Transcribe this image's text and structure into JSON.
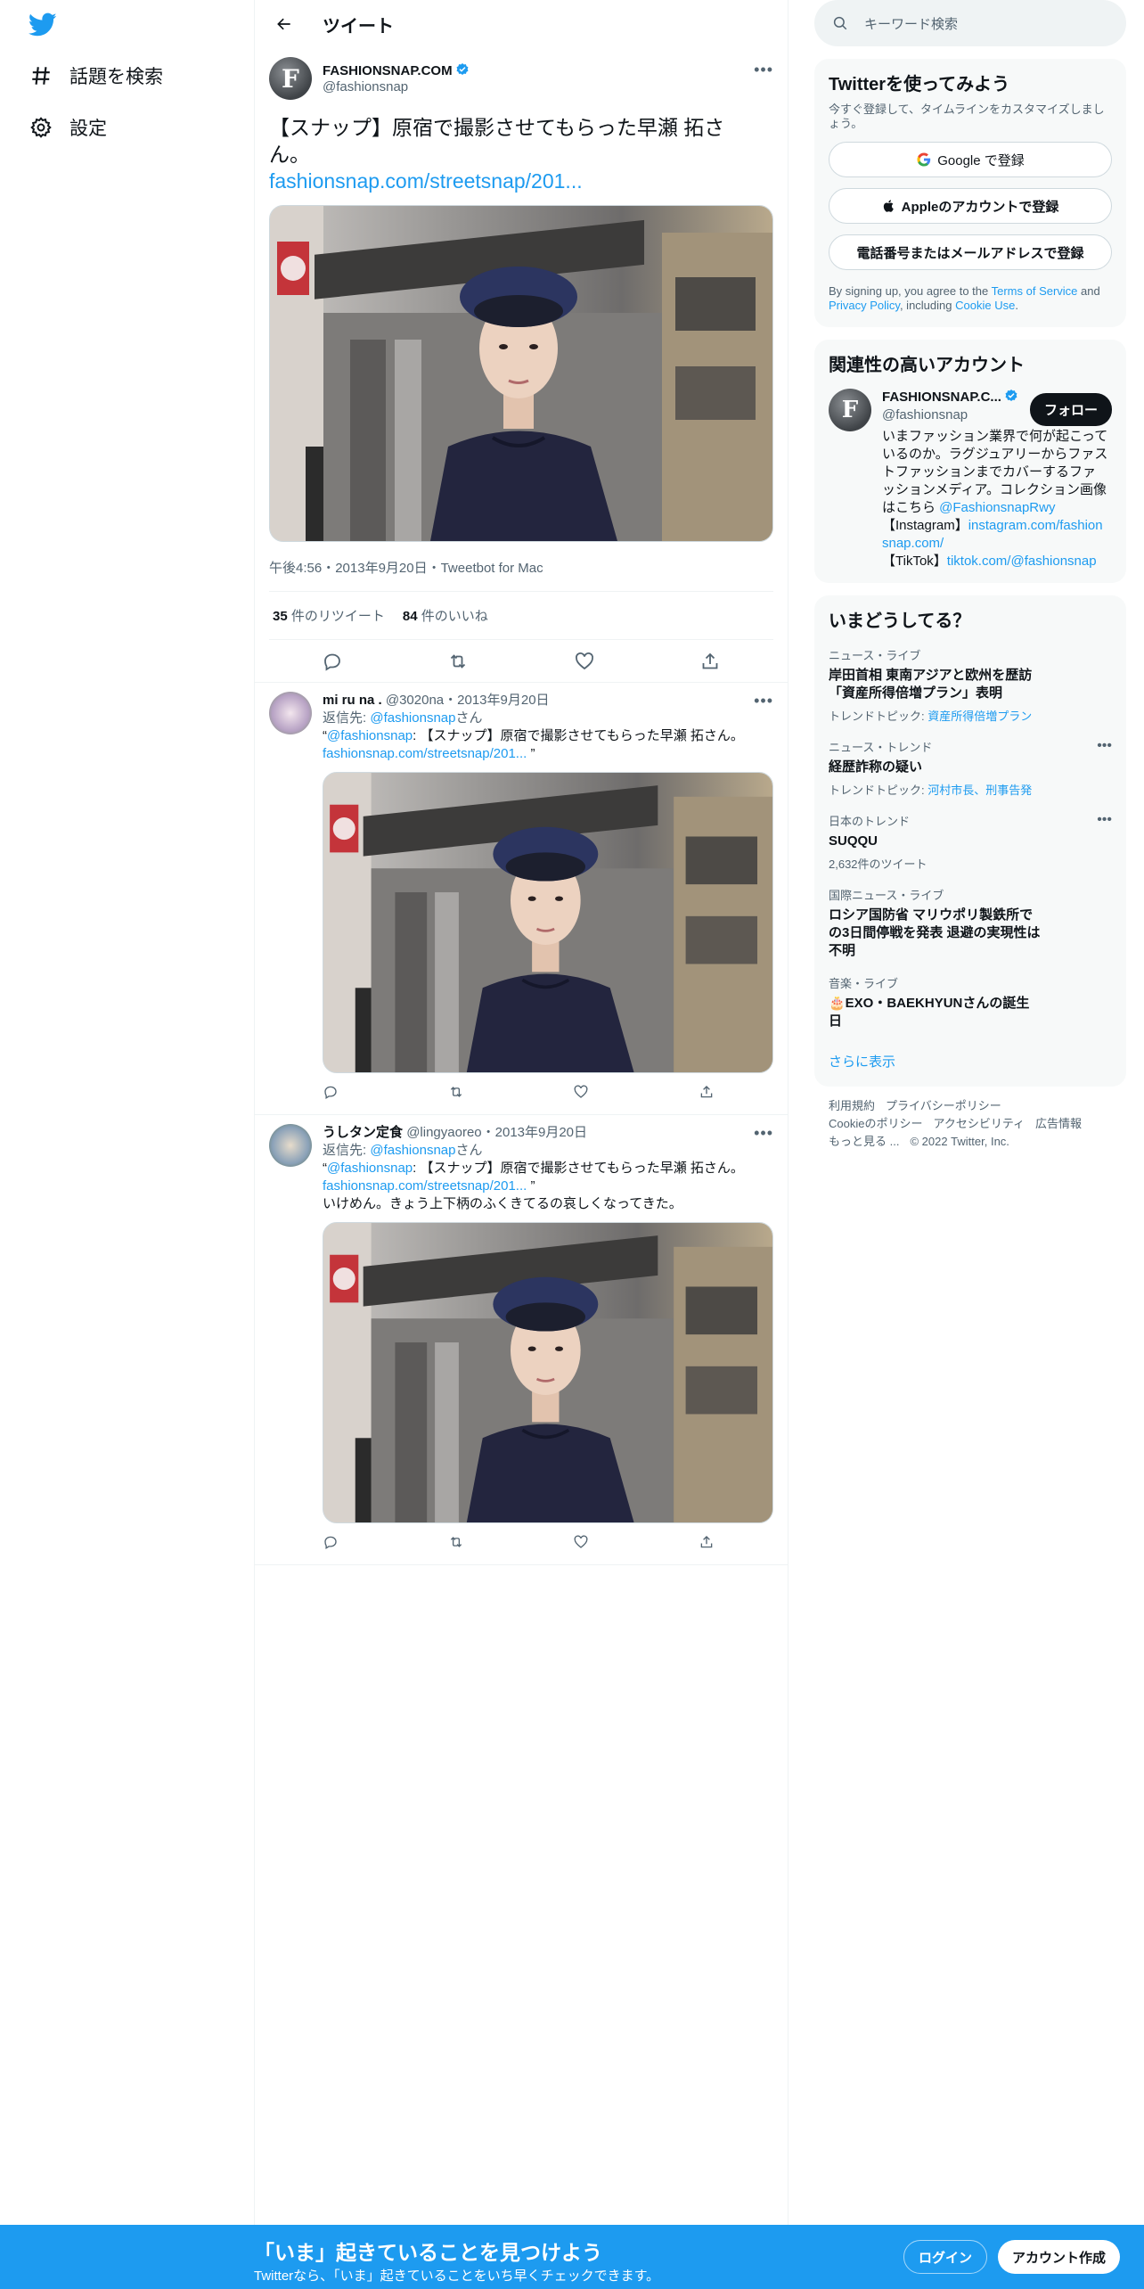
{
  "nav": {
    "items": [
      {
        "label": "話題を検索",
        "icon": "hashtag-icon"
      },
      {
        "label": "設定",
        "icon": "gear-icon"
      }
    ]
  },
  "header": {
    "title": "ツイート"
  },
  "tweet": {
    "author_name": "FASHIONSNAP.COM",
    "author_handle": "@fashionsnap",
    "text": "【スナップ】原宿で撮影させてもらった早瀬 拓さん。",
    "link": "fashionsnap.com/streetsnap/201...",
    "meta": "午後4:56・2013年9月20日・Tweetbot for Mac",
    "retweets_count": "35",
    "retweets_label": " 件のリツイート",
    "likes_count": "84",
    "likes_label": " 件のいいね"
  },
  "replies": [
    {
      "name": "mi ru na .",
      "handle_date": "@3020na・2013年9月20日",
      "reply_prefix": "返信先: ",
      "reply_to": "@fashionsnap",
      "reply_suffix": "さん",
      "quote_open": "“",
      "quote_mention": "@fashionsnap",
      "quote_text": ": 【スナップ】原宿で撮影させてもらった早瀬 拓さん。",
      "quote_link": "fashionsnap.com/streetsnap/201...",
      "quote_close": " ”",
      "extra": ""
    },
    {
      "name": "うしタン定食",
      "handle_date": "@lingyaoreo・2013年9月20日",
      "reply_prefix": "返信先: ",
      "reply_to": "@fashionsnap",
      "reply_suffix": "さん",
      "quote_open": "“",
      "quote_mention": "@fashionsnap",
      "quote_text": ": 【スナップ】原宿で撮影させてもらった早瀬 拓さん。",
      "quote_link": "fashionsnap.com/streetsnap/201...",
      "quote_close": " ”",
      "extra": "いけめん。きょう上下柄のふくきてるの哀しくなってきた。"
    }
  ],
  "search": {
    "placeholder": "キーワード検索"
  },
  "signup_card": {
    "title": "Twitterを使ってみよう",
    "subtitle": "今すぐ登録して、タイムラインをカスタマイズしましょう。",
    "google": "Google で登録",
    "apple": "Appleのアカウントで登録",
    "phone": "電話番号またはメールアドレスで登録",
    "terms_1": "By signing up, you agree to the ",
    "terms_link1": "Terms of Service",
    "terms_2": " and ",
    "terms_link2": "Privacy Policy",
    "terms_3": ", including ",
    "terms_link3": "Cookie Use",
    "terms_4": "."
  },
  "related": {
    "title": "関連性の高いアカウント",
    "name": "FASHIONSNAP.C...",
    "handle": "@fashionsnap",
    "follow": "フォロー",
    "bio_1": "いまファッション業界で何が起こっているのか。ラグジュアリーからファストファッションまでカバーするファッションメディア。コレクション画像はこちら ",
    "bio_link1": "@FashionsnapRwy",
    "bio_2": "【Instagram】",
    "bio_link2": "instagram.com/fashionsnap.com/",
    "bio_3": "【TikTok】",
    "bio_link3": "tiktok.com/@fashionsnap"
  },
  "trends": {
    "title": "いまどうしてる？",
    "items": [
      {
        "category": "ニュース・ライブ",
        "title": "岸田首相 東南アジアと欧州を歴訪「資産所得倍増プラン」表明",
        "topic_prefix": "トレンドトピック: ",
        "topic": "資産所得倍増プラン",
        "has_more": false
      },
      {
        "category": "ニュース・トレンド",
        "title": "経歴詐称の疑い",
        "topic_prefix": "トレンドトピック: ",
        "topic": "河村市長、刑事告発",
        "has_more": true
      },
      {
        "category": "日本のトレンド",
        "title": "SUQQU",
        "count": "2,632件のツイート",
        "has_more": true
      },
      {
        "category": "国際ニュース・ライブ",
        "title": "ロシア国防省 マリウポリ製鉄所での3日間停戦を発表 退避の実現性は不明",
        "has_more": false
      },
      {
        "category": "音楽・ライブ",
        "title": "🎂EXO・BAEKHYUNさんの誕生日",
        "has_more": false
      }
    ],
    "show_more": "さらに表示"
  },
  "footer": {
    "links": [
      "利用規約",
      "プライバシーポリシー",
      "Cookieのポリシー",
      "アクセシビリティ",
      "広告情報",
      "もっと見る ..."
    ],
    "copyright": "© 2022 Twitter, Inc."
  },
  "bottombar": {
    "title": "「いま」起きていることを見つけよう",
    "subtitle": "Twitterなら、「いま」起きていることをいち早くチェックできます。",
    "login": "ログイン",
    "signup": "アカウント作成"
  },
  "colors": {
    "accent": "#1d9bf0",
    "text": "#0f1419",
    "muted": "#536471"
  }
}
